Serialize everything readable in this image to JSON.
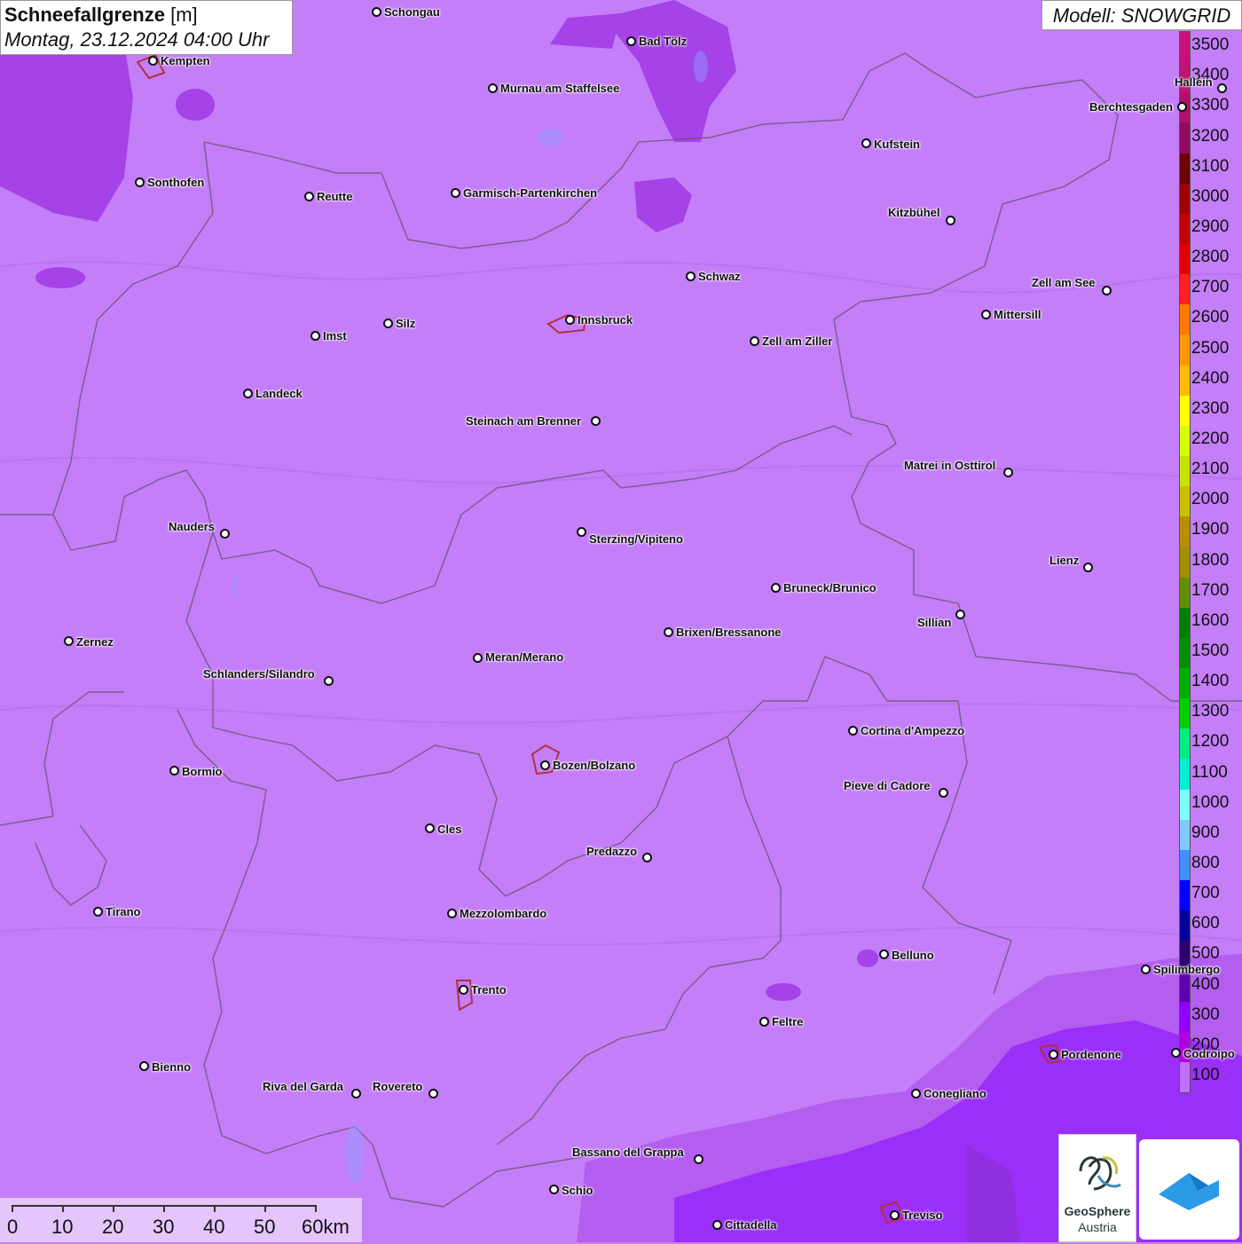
{
  "title": {
    "main": "Schneefallgrenze",
    "unit": "[m]",
    "date": "Montag, 23.12.2024 04:00 Uhr"
  },
  "model": "Modell: SNOWGRID",
  "legend": {
    "labels": [
      "3500",
      "3400",
      "3300",
      "3200",
      "3100",
      "3000",
      "2900",
      "2800",
      "2700",
      "2600",
      "2500",
      "2400",
      "2300",
      "2200",
      "2100",
      "2000",
      "1900",
      "1800",
      "1700",
      "1600",
      "1500",
      "1400",
      "1300",
      "1200",
      "1100",
      "1000",
      "900",
      "800",
      "700",
      "600",
      "500",
      "400",
      "300",
      "200",
      "100"
    ],
    "colors": [
      "#c8107a",
      "#c0146e",
      "#b0126a",
      "#900c60",
      "#700000",
      "#a00000",
      "#c40000",
      "#e00000",
      "#ff2020",
      "#ff7b00",
      "#ff9a00",
      "#ffbb00",
      "#ffff00",
      "#d4ff00",
      "#c4e400",
      "#c8c000",
      "#b89000",
      "#a09000",
      "#609000",
      "#008000",
      "#009000",
      "#00b000",
      "#00d000",
      "#00f080",
      "#00f0d0",
      "#80ffff",
      "#80c8ff",
      "#4090ff",
      "#0000ff",
      "#0000a0",
      "#300070",
      "#6000b0",
      "#9000ff",
      "#b000e0",
      "#c070ff"
    ]
  },
  "cities": [
    {
      "name": "Schongau"
    },
    {
      "name": "Bad Tölz"
    },
    {
      "name": "Kempten"
    },
    {
      "name": "Murnau am Staffelsee"
    },
    {
      "name": "Hallein"
    },
    {
      "name": "Berchtesgaden"
    },
    {
      "name": "Kufstein"
    },
    {
      "name": "Sonthofen"
    },
    {
      "name": "Reutte"
    },
    {
      "name": "Garmisch-Partenkirchen"
    },
    {
      "name": "Kitzbühel"
    },
    {
      "name": "Schwaz"
    },
    {
      "name": "Zell am See"
    },
    {
      "name": "Innsbruck"
    },
    {
      "name": "Mittersill"
    },
    {
      "name": "Imst"
    },
    {
      "name": "Silz"
    },
    {
      "name": "Zell am Ziller"
    },
    {
      "name": "Landeck"
    },
    {
      "name": "Steinach am Brenner"
    },
    {
      "name": "Matrei in Osttirol"
    },
    {
      "name": "Nauders"
    },
    {
      "name": "Sterzing/Vipiteno"
    },
    {
      "name": "Lienz"
    },
    {
      "name": "Bruneck/Brunico"
    },
    {
      "name": "Sillian"
    },
    {
      "name": "Zernez"
    },
    {
      "name": "Brixen/Bressanone"
    },
    {
      "name": "Meran/Merano"
    },
    {
      "name": "Schlanders/Silandro"
    },
    {
      "name": "Cortina d'Ampezzo"
    },
    {
      "name": "Bozen/Bolzano"
    },
    {
      "name": "Bormio"
    },
    {
      "name": "Pieve di Cadore"
    },
    {
      "name": "Cles"
    },
    {
      "name": "Predazzo"
    },
    {
      "name": "Tirano"
    },
    {
      "name": "Mezzolombardo"
    },
    {
      "name": "Belluno"
    },
    {
      "name": "Spilimbergo"
    },
    {
      "name": "Trento"
    },
    {
      "name": "Feltre"
    },
    {
      "name": "Pordenone"
    },
    {
      "name": "Codroipo"
    },
    {
      "name": "Bienno"
    },
    {
      "name": "Riva del Garda"
    },
    {
      "name": "Rovereto"
    },
    {
      "name": "Conegliano"
    },
    {
      "name": "Bassano del Grappa"
    },
    {
      "name": "Schio"
    },
    {
      "name": "Treviso"
    },
    {
      "name": "Cittadella"
    }
  ],
  "scale": {
    "labels": [
      "0",
      "10",
      "20",
      "30",
      "40",
      "50",
      "60km"
    ]
  },
  "logo": {
    "line1": "GeoSphere",
    "line2": "Austria"
  }
}
